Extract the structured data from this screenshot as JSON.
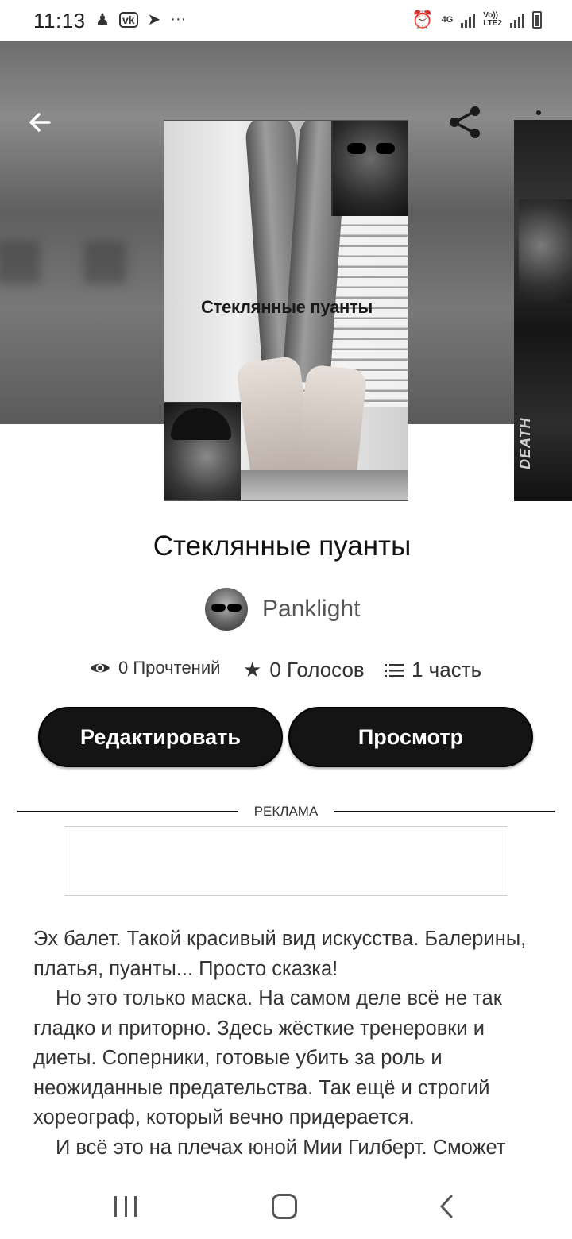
{
  "status_bar": {
    "time": "11:13",
    "notification_icons": [
      "person-icon",
      "vk-icon",
      "telegram-icon",
      "more-dots-icon"
    ],
    "more_glyph": "···",
    "network_4g": "4G",
    "volte": "Vo))",
    "lte2": "LTE2",
    "right_icons": [
      "alarm-icon",
      "signal-icon",
      "battery-icon"
    ]
  },
  "toolbar": {
    "back_icon": "arrow-left-icon",
    "share_icon": "share-icon",
    "more_icon": "more-vert-icon"
  },
  "cover": {
    "title_text": "Стеклянные пуанты"
  },
  "next_cover": {
    "text": "DEATH"
  },
  "book": {
    "title": "Стеклянные пуанты",
    "author": "Panklight"
  },
  "stats": {
    "reads": "0 Прочтений",
    "votes": "0 Голосов",
    "parts": "1 часть"
  },
  "actions": {
    "edit_label": "Редактировать",
    "preview_label": "Просмотр"
  },
  "ad": {
    "label": "РЕКЛАМА"
  },
  "description": {
    "p1": "Эх балет. Такой красивый вид искусства. Балерины, платья, пуанты... Просто сказка!",
    "p2": "Но это только маска. На самом деле всё не так гладко и приторно. Здесь жёсткие тренеровки и диеты. Соперники, готовые убить за роль и неожиданные предательства. Так ещё и строгий хореограф, который вечно придерается.",
    "p3": "И всё это на плечах юной Мии Гилберт. Сможет"
  },
  "nav_bar": {
    "icons": [
      "recents-icon",
      "home-icon",
      "back-icon"
    ]
  }
}
